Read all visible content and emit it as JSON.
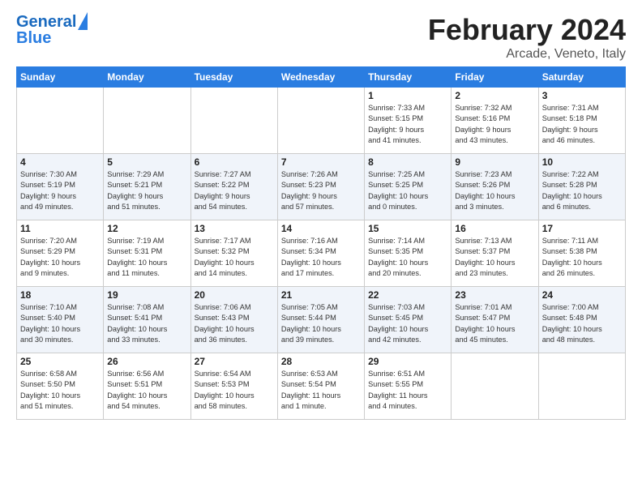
{
  "header": {
    "logo_line1": "General",
    "logo_line2": "Blue",
    "title": "February 2024",
    "subtitle": "Arcade, Veneto, Italy"
  },
  "weekdays": [
    "Sunday",
    "Monday",
    "Tuesday",
    "Wednesday",
    "Thursday",
    "Friday",
    "Saturday"
  ],
  "weeks": [
    [
      {
        "day": "",
        "info": ""
      },
      {
        "day": "",
        "info": ""
      },
      {
        "day": "",
        "info": ""
      },
      {
        "day": "",
        "info": ""
      },
      {
        "day": "1",
        "info": "Sunrise: 7:33 AM\nSunset: 5:15 PM\nDaylight: 9 hours\nand 41 minutes."
      },
      {
        "day": "2",
        "info": "Sunrise: 7:32 AM\nSunset: 5:16 PM\nDaylight: 9 hours\nand 43 minutes."
      },
      {
        "day": "3",
        "info": "Sunrise: 7:31 AM\nSunset: 5:18 PM\nDaylight: 9 hours\nand 46 minutes."
      }
    ],
    [
      {
        "day": "4",
        "info": "Sunrise: 7:30 AM\nSunset: 5:19 PM\nDaylight: 9 hours\nand 49 minutes."
      },
      {
        "day": "5",
        "info": "Sunrise: 7:29 AM\nSunset: 5:21 PM\nDaylight: 9 hours\nand 51 minutes."
      },
      {
        "day": "6",
        "info": "Sunrise: 7:27 AM\nSunset: 5:22 PM\nDaylight: 9 hours\nand 54 minutes."
      },
      {
        "day": "7",
        "info": "Sunrise: 7:26 AM\nSunset: 5:23 PM\nDaylight: 9 hours\nand 57 minutes."
      },
      {
        "day": "8",
        "info": "Sunrise: 7:25 AM\nSunset: 5:25 PM\nDaylight: 10 hours\nand 0 minutes."
      },
      {
        "day": "9",
        "info": "Sunrise: 7:23 AM\nSunset: 5:26 PM\nDaylight: 10 hours\nand 3 minutes."
      },
      {
        "day": "10",
        "info": "Sunrise: 7:22 AM\nSunset: 5:28 PM\nDaylight: 10 hours\nand 6 minutes."
      }
    ],
    [
      {
        "day": "11",
        "info": "Sunrise: 7:20 AM\nSunset: 5:29 PM\nDaylight: 10 hours\nand 9 minutes."
      },
      {
        "day": "12",
        "info": "Sunrise: 7:19 AM\nSunset: 5:31 PM\nDaylight: 10 hours\nand 11 minutes."
      },
      {
        "day": "13",
        "info": "Sunrise: 7:17 AM\nSunset: 5:32 PM\nDaylight: 10 hours\nand 14 minutes."
      },
      {
        "day": "14",
        "info": "Sunrise: 7:16 AM\nSunset: 5:34 PM\nDaylight: 10 hours\nand 17 minutes."
      },
      {
        "day": "15",
        "info": "Sunrise: 7:14 AM\nSunset: 5:35 PM\nDaylight: 10 hours\nand 20 minutes."
      },
      {
        "day": "16",
        "info": "Sunrise: 7:13 AM\nSunset: 5:37 PM\nDaylight: 10 hours\nand 23 minutes."
      },
      {
        "day": "17",
        "info": "Sunrise: 7:11 AM\nSunset: 5:38 PM\nDaylight: 10 hours\nand 26 minutes."
      }
    ],
    [
      {
        "day": "18",
        "info": "Sunrise: 7:10 AM\nSunset: 5:40 PM\nDaylight: 10 hours\nand 30 minutes."
      },
      {
        "day": "19",
        "info": "Sunrise: 7:08 AM\nSunset: 5:41 PM\nDaylight: 10 hours\nand 33 minutes."
      },
      {
        "day": "20",
        "info": "Sunrise: 7:06 AM\nSunset: 5:43 PM\nDaylight: 10 hours\nand 36 minutes."
      },
      {
        "day": "21",
        "info": "Sunrise: 7:05 AM\nSunset: 5:44 PM\nDaylight: 10 hours\nand 39 minutes."
      },
      {
        "day": "22",
        "info": "Sunrise: 7:03 AM\nSunset: 5:45 PM\nDaylight: 10 hours\nand 42 minutes."
      },
      {
        "day": "23",
        "info": "Sunrise: 7:01 AM\nSunset: 5:47 PM\nDaylight: 10 hours\nand 45 minutes."
      },
      {
        "day": "24",
        "info": "Sunrise: 7:00 AM\nSunset: 5:48 PM\nDaylight: 10 hours\nand 48 minutes."
      }
    ],
    [
      {
        "day": "25",
        "info": "Sunrise: 6:58 AM\nSunset: 5:50 PM\nDaylight: 10 hours\nand 51 minutes."
      },
      {
        "day": "26",
        "info": "Sunrise: 6:56 AM\nSunset: 5:51 PM\nDaylight: 10 hours\nand 54 minutes."
      },
      {
        "day": "27",
        "info": "Sunrise: 6:54 AM\nSunset: 5:53 PM\nDaylight: 10 hours\nand 58 minutes."
      },
      {
        "day": "28",
        "info": "Sunrise: 6:53 AM\nSunset: 5:54 PM\nDaylight: 11 hours\nand 1 minute."
      },
      {
        "day": "29",
        "info": "Sunrise: 6:51 AM\nSunset: 5:55 PM\nDaylight: 11 hours\nand 4 minutes."
      },
      {
        "day": "",
        "info": ""
      },
      {
        "day": "",
        "info": ""
      }
    ]
  ]
}
